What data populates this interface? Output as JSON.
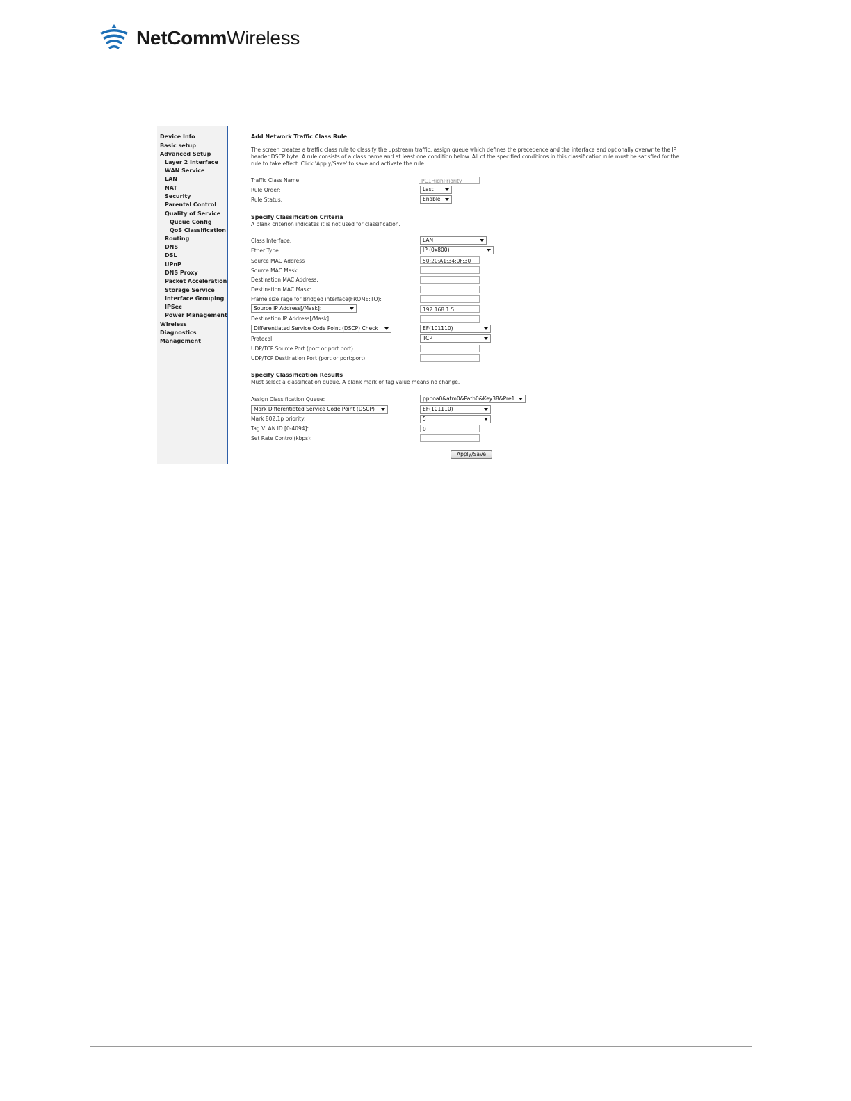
{
  "brand": {
    "bold": "NetComm",
    "light": "Wireless",
    "icon": "wifi-logo-icon",
    "color": "#1c6fb6"
  },
  "sidebar": {
    "accent": "#2f5fa8",
    "items": [
      {
        "label": "Device Info"
      },
      {
        "label": "Basic setup"
      },
      {
        "label": "Advanced Setup"
      },
      {
        "label": "Layer 2 Interface"
      },
      {
        "label": "WAN Service"
      },
      {
        "label": "LAN"
      },
      {
        "label": "NAT"
      },
      {
        "label": "Security"
      },
      {
        "label": "Parental Control"
      },
      {
        "label": "Quality of Service"
      },
      {
        "label": "Queue Config"
      },
      {
        "label": "QoS Classification"
      },
      {
        "label": "Routing"
      },
      {
        "label": "DNS"
      },
      {
        "label": "DSL"
      },
      {
        "label": "UPnP"
      },
      {
        "label": "DNS Proxy"
      },
      {
        "label": "Packet Acceleration"
      },
      {
        "label": "Storage Service"
      },
      {
        "label": "Interface Grouping"
      },
      {
        "label": "IPSec"
      },
      {
        "label": "Power Management"
      },
      {
        "label": "Wireless"
      },
      {
        "label": "Diagnostics"
      },
      {
        "label": "Management"
      }
    ]
  },
  "form": {
    "title": "Add Network Traffic Class Rule",
    "description": "The screen creates a traffic class rule to classify the upstream traffic, assign queue which defines the precedence and the interface and optionally overwrite the IP header DSCP byte. A rule consists of a class name and at least one condition below. All of the specified conditions in this classification rule must be satisfied for the rule to take effect. Click 'Apply/Save' to save and activate the rule.",
    "traffic_class_name": {
      "label": "Traffic Class Name:",
      "value": "PC1HighPriority"
    },
    "rule_order": {
      "label": "Rule Order:",
      "value": "Last"
    },
    "rule_status": {
      "label": "Rule Status:",
      "value": "Enable"
    },
    "criteria": {
      "title": "Specify Classification Criteria",
      "note": "A blank criterion indicates it is not used for classification.",
      "class_interface": {
        "label": "Class Interface:",
        "value": "LAN"
      },
      "ether_type": {
        "label": "Ether Type:",
        "value": "IP (0x800)"
      },
      "source_mac": {
        "label": "Source MAC Address",
        "value": "50:20:A1:34:0F:30"
      },
      "source_mac_mask": {
        "label": "Source MAC Mask:",
        "value": ""
      },
      "dest_mac": {
        "label": "Destination MAC Address:",
        "value": ""
      },
      "dest_mac_mask": {
        "label": "Destination MAC Mask:",
        "value": ""
      },
      "frame_size": {
        "label": "Frame size rage for Bridged interface(FROME:TO):",
        "value": ""
      },
      "source_ip_select": {
        "value": "Source IP Address[/Mask]:"
      },
      "source_ip": {
        "value": "192.168.1.5"
      },
      "dest_ip": {
        "label": "Destination IP Address[/Mask]:",
        "value": ""
      },
      "dscp_check_select": {
        "value": "Differentiated Service Code Point (DSCP) Check"
      },
      "dscp_check": {
        "value": "EF(101110)"
      },
      "protocol": {
        "label": "Protocol:",
        "value": "TCP"
      },
      "udp_tcp_src_port": {
        "label": "UDP/TCP Source Port (port or port:port):",
        "value": ""
      },
      "udp_tcp_dst_port": {
        "label": "UDP/TCP Destination Port (port or port:port):",
        "value": ""
      }
    },
    "results": {
      "title": "Specify Classification Results",
      "note": "Must select a classification queue. A blank mark or tag value means no change.",
      "queue": {
        "label": "Assign Classification Queue:",
        "value": "pppoa0&atm0&Path0&Key38&Pre1"
      },
      "mark_dscp_select": {
        "value": "Mark Differentiated Service Code Point (DSCP)"
      },
      "mark_dscp": {
        "value": "EF(101110)"
      },
      "priority": {
        "label": "Mark 802.1p priority:",
        "value": "5"
      },
      "vlan": {
        "label": "Tag VLAN ID [0-4094]:",
        "value": "0"
      },
      "rate": {
        "label": "Set Rate Control(kbps):",
        "value": ""
      }
    },
    "apply_label": "Apply/Save"
  }
}
